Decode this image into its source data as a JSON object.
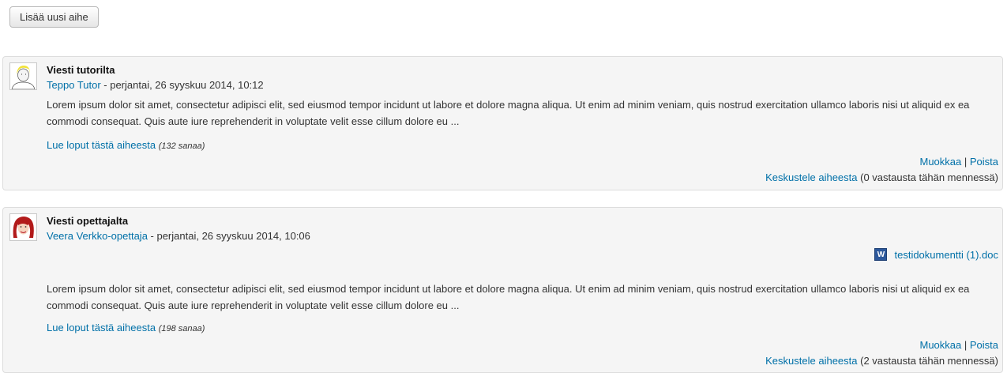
{
  "toolbar": {
    "add_topic_label": "Lisää uusi aihe"
  },
  "posts": [
    {
      "subject": "Viesti tutorilta",
      "author": "Teppo Tutor",
      "date": " - perjantai, 26 syyskuu 2014, 10:12",
      "body": "Lorem ipsum dolor sit amet, consectetur adipisci elit, sed eiusmod tempor incidunt ut labore et dolore magna aliqua. Ut enim ad minim veniam, quis nostrud exercitation ullamco laboris nisi ut aliquid ex ea commodi consequat. Quis aute iure reprehenderit in voluptate velit esse cillum dolore eu ...",
      "read_more": "Lue loput tästä aiheesta",
      "word_count": "(132 sanaa)",
      "edit": "Muokkaa",
      "separator": " | ",
      "delete": "Poista",
      "discuss": "Keskustele aiheesta",
      "replies": " (0 vastausta tähän mennessä)"
    },
    {
      "subject": "Viesti opettajalta",
      "author": "Veera Verkko-opettaja",
      "date": " - perjantai, 26 syyskuu 2014, 10:06",
      "attachment": "testidokumentti (1).doc",
      "attachment_icon": "W",
      "body": "Lorem ipsum dolor sit amet, consectetur adipisci elit, sed eiusmod tempor incidunt ut labore et dolore magna aliqua. Ut enim ad minim veniam, quis nostrud exercitation ullamco laboris nisi ut aliquid ex ea commodi consequat. Quis aute iure reprehenderit in voluptate velit esse cillum dolore eu ...",
      "read_more": "Lue loput tästä aiheesta",
      "word_count": "(198 sanaa)",
      "edit": "Muokkaa",
      "separator": " | ",
      "delete": "Poista",
      "discuss": "Keskustele aiheesta",
      "replies": " (2 vastausta tähän mennessä)"
    }
  ]
}
